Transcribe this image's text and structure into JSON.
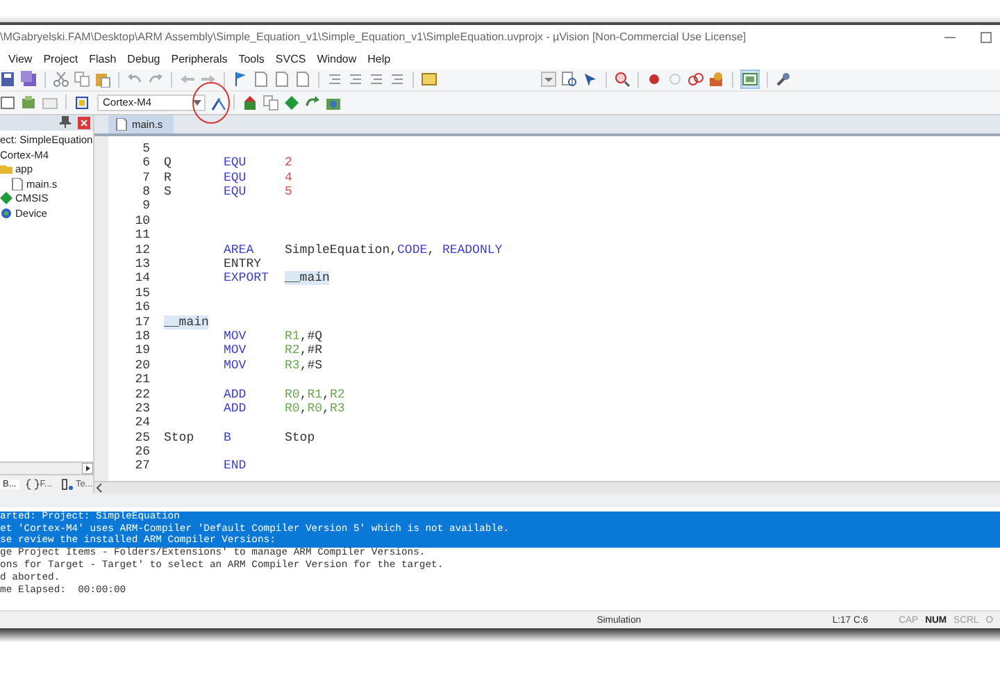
{
  "window": {
    "title": "\\MGabryelski.FAM\\Desktop\\ARM Assembly\\Simple_Equation_v1\\Simple_Equation_v1\\SimpleEquation.uvprojx - µVision  [Non-Commercial Use License]"
  },
  "menu": [
    "View",
    "Project",
    "Flash",
    "Debug",
    "Peripherals",
    "Tools",
    "SVCS",
    "Window",
    "Help"
  ],
  "toolbar": {
    "target": "Cortex-M4"
  },
  "project_panel": {
    "tree": [
      {
        "label": "ect: SimpleEquation",
        "children": [
          {
            "label": "Cortex-M4",
            "children": [
              {
                "label": "app",
                "kind": "group",
                "children": [
                  {
                    "label": "main.s",
                    "kind": "file"
                  }
                ]
              },
              {
                "label": "CMSIS",
                "kind": "component"
              },
              {
                "label": "Device",
                "kind": "device"
              }
            ]
          }
        ]
      }
    ],
    "tabs": [
      {
        "label": "B...",
        "selected": true
      },
      {
        "label": "F...",
        "selected": false
      },
      {
        "label": "Te...",
        "selected": false
      }
    ]
  },
  "editor": {
    "tabs": [
      {
        "label": "main.s",
        "selected": true
      }
    ],
    "lines": [
      {
        "number": "5"
      },
      {
        "number": "6",
        "label": [
          {
            "text": "Q",
            "kind": "plain"
          }
        ],
        "op": [
          {
            "text": "EQU",
            "kind": "keyword"
          }
        ],
        "operands": [
          {
            "text": "2",
            "kind": "number"
          }
        ]
      },
      {
        "number": "7",
        "label": [
          {
            "text": "R",
            "kind": "plain"
          }
        ],
        "op": [
          {
            "text": "EQU",
            "kind": "keyword"
          }
        ],
        "operands": [
          {
            "text": "4",
            "kind": "number"
          }
        ]
      },
      {
        "number": "8",
        "label": [
          {
            "text": "S",
            "kind": "plain"
          }
        ],
        "op": [
          {
            "text": "EQU",
            "kind": "keyword"
          }
        ],
        "operands": [
          {
            "text": "5",
            "kind": "number"
          }
        ]
      },
      {
        "number": "9"
      },
      {
        "number": "10"
      },
      {
        "number": "11"
      },
      {
        "number": "12",
        "op": [
          {
            "text": "AREA",
            "kind": "keyword"
          }
        ],
        "operands": [
          {
            "text": "SimpleEquation,",
            "kind": "plain"
          },
          {
            "text": "CODE",
            "kind": "keyword"
          },
          {
            "text": ", ",
            "kind": "plain"
          },
          {
            "text": "READONLY",
            "kind": "keyword"
          }
        ]
      },
      {
        "number": "13",
        "op": [
          {
            "text": "ENTRY",
            "kind": "plain"
          }
        ]
      },
      {
        "number": "14",
        "op": [
          {
            "text": "EXPORT",
            "kind": "keyword"
          }
        ],
        "operands": [
          {
            "text": "__main",
            "kind": "highlight"
          }
        ]
      },
      {
        "number": "15"
      },
      {
        "number": "16"
      },
      {
        "number": "17",
        "label": [
          {
            "text": "__main",
            "kind": "highlight"
          }
        ]
      },
      {
        "number": "18",
        "op": [
          {
            "text": "MOV",
            "kind": "keyword"
          }
        ],
        "operands": [
          {
            "text": "R1",
            "kind": "register"
          },
          {
            "text": ",#Q",
            "kind": "plain"
          }
        ]
      },
      {
        "number": "19",
        "op": [
          {
            "text": "MOV",
            "kind": "keyword"
          }
        ],
        "operands": [
          {
            "text": "R2",
            "kind": "register"
          },
          {
            "text": ",#R",
            "kind": "plain"
          }
        ]
      },
      {
        "number": "20",
        "op": [
          {
            "text": "MOV",
            "kind": "keyword"
          }
        ],
        "operands": [
          {
            "text": "R3",
            "kind": "register"
          },
          {
            "text": ",#S",
            "kind": "plain"
          }
        ]
      },
      {
        "number": "21"
      },
      {
        "number": "22",
        "op": [
          {
            "text": "ADD",
            "kind": "keyword"
          }
        ],
        "operands": [
          {
            "text": "R0",
            "kind": "register"
          },
          {
            "text": ",",
            "kind": "plain"
          },
          {
            "text": "R1",
            "kind": "register"
          },
          {
            "text": ",",
            "kind": "plain"
          },
          {
            "text": "R2",
            "kind": "register"
          }
        ]
      },
      {
        "number": "23",
        "op": [
          {
            "text": "ADD",
            "kind": "keyword"
          }
        ],
        "operands": [
          {
            "text": "R0",
            "kind": "register"
          },
          {
            "text": ",",
            "kind": "plain"
          },
          {
            "text": "R0",
            "kind": "register"
          },
          {
            "text": ",",
            "kind": "plain"
          },
          {
            "text": "R3",
            "kind": "register"
          }
        ]
      },
      {
        "number": "24"
      },
      {
        "number": "25",
        "label": [
          {
            "text": "Stop",
            "kind": "plain"
          }
        ],
        "op": [
          {
            "text": "B",
            "kind": "keyword"
          }
        ],
        "operands": [
          {
            "text": "Stop",
            "kind": "plain"
          }
        ]
      },
      {
        "number": "26"
      },
      {
        "number": "27",
        "op": [
          {
            "text": "END",
            "kind": "keyword"
          }
        ]
      }
    ]
  },
  "build_output": {
    "lines": [
      {
        "text": "arted: Project: SimpleEquation",
        "selected": true
      },
      {
        "text": "et 'Cortex-M4' uses ARM-Compiler 'Default Compiler Version 5' which is not available.",
        "selected": true
      },
      {
        "text": "se review the installed ARM Compiler Versions:",
        "selected": true
      },
      {
        "text": "ge Project Items - Folders/Extensions' to manage ARM Compiler Versions.",
        "selected": false
      },
      {
        "text": "ons for Target - Target' to select an ARM Compiler Version for the target.",
        "selected": false
      },
      {
        "text": "d aborted.",
        "selected": false
      },
      {
        "text": "me Elapsed:  00:00:00",
        "selected": false
      }
    ]
  },
  "status_bar": {
    "mode": "Simulation",
    "position": "L:17 C:6",
    "indicators": [
      {
        "label": "CAP",
        "on": false
      },
      {
        "label": "NUM",
        "on": true
      },
      {
        "label": "SCRL",
        "on": false
      },
      {
        "label": "O",
        "on": false
      }
    ]
  }
}
